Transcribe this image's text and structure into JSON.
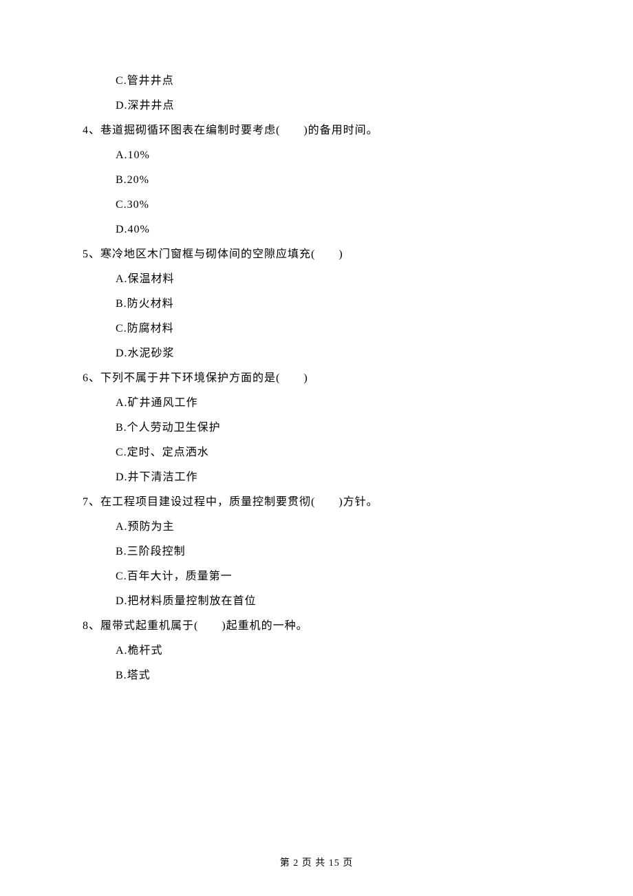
{
  "q3_options_tail": {
    "c": "C.管井井点",
    "d": "D.深井井点"
  },
  "q4": {
    "stem": "4、巷道掘砌循环图表在编制时要考虑(　　)的备用时间。",
    "a": "A.10%",
    "b": "B.20%",
    "c": "C.30%",
    "d": "D.40%"
  },
  "q5": {
    "stem": "5、寒冷地区木门窗框与砌体间的空隙应填充(　　)",
    "a": "A.保温材料",
    "b": "B.防火材料",
    "c": "C.防腐材料",
    "d": "D.水泥砂浆"
  },
  "q6": {
    "stem": "6、下列不属于井下环境保护方面的是(　　)",
    "a": "A.矿井通风工作",
    "b": "B.个人劳动卫生保护",
    "c": "C.定时、定点洒水",
    "d": "D.井下清洁工作"
  },
  "q7": {
    "stem": "7、在工程项目建设过程中，质量控制要贯彻(　　)方针。",
    "a": "A.预防为主",
    "b": "B.三阶段控制",
    "c": "C.百年大计，质量第一",
    "d": "D.把材料质量控制放在首位"
  },
  "q8": {
    "stem": "8、履带式起重机属于(　　)起重机的一种。",
    "a": "A.桅杆式",
    "b": "B.塔式"
  },
  "footer": "第 2 页 共 15 页"
}
